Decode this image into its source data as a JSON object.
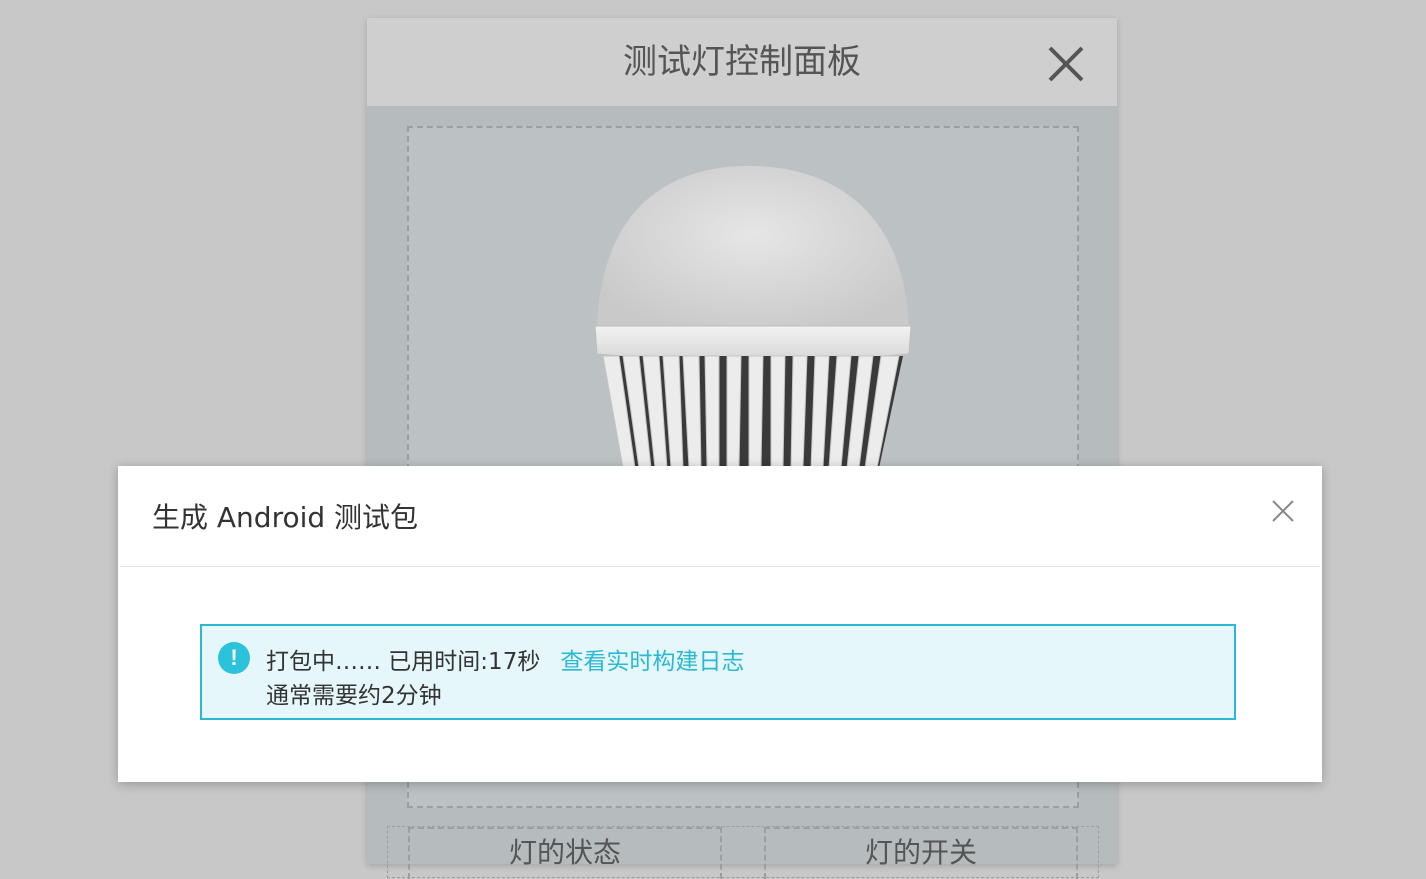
{
  "panel": {
    "title": "测试灯控制面板",
    "status_label": "灯的状态",
    "switch_label": "灯的开关"
  },
  "dialog": {
    "title": "生成 Android 测试包",
    "alert": {
      "status_text": "打包中…… 已用时间:17秒",
      "link_text": "查看实时构建日志",
      "note_text": "通常需要约2分钟"
    }
  },
  "colors": {
    "accent": "#2bb8d3",
    "alert_bg": "#e6f7fb",
    "page_bg": "#c8c8c8"
  }
}
